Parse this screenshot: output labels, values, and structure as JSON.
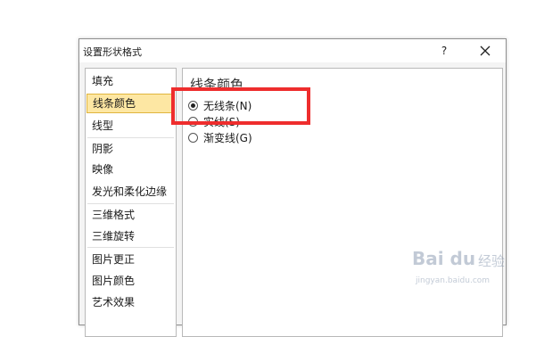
{
  "dialog": {
    "title": "设置形状格式",
    "help_label": "?",
    "close_icon": "close-icon"
  },
  "nav": {
    "items": [
      {
        "label": "填充",
        "selected": false
      },
      {
        "label": "线条颜色",
        "selected": true
      },
      {
        "label": "线型",
        "selected": false
      },
      {
        "label": "阴影",
        "selected": false
      },
      {
        "label": "映像",
        "selected": false
      },
      {
        "label": "发光和柔化边缘",
        "selected": false
      },
      {
        "label": "三维格式",
        "selected": false
      },
      {
        "label": "三维旋转",
        "selected": false
      },
      {
        "label": "图片更正",
        "selected": false
      },
      {
        "label": "图片颜色",
        "selected": false
      },
      {
        "label": "艺术效果",
        "selected": false
      }
    ]
  },
  "content": {
    "section_title": "线条颜色",
    "options": [
      {
        "label": "无线条(N)",
        "checked": true
      },
      {
        "label": "实线(S)",
        "checked": false
      },
      {
        "label": "渐变线(G)",
        "checked": false
      }
    ]
  },
  "annotation": {
    "color": "#ee2d2d"
  },
  "watermark": {
    "brand": "Bai du",
    "suffix": "经验",
    "url": "jingyan.baidu.com"
  }
}
